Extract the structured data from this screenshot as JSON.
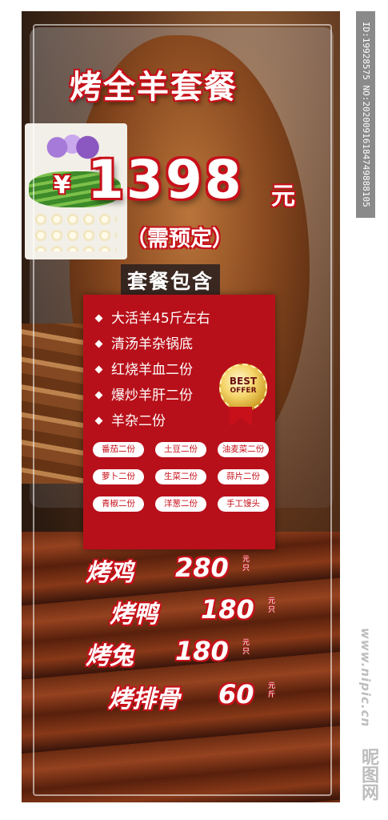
{
  "poster": {
    "title": "烤全羊套餐",
    "price": {
      "currency": "¥",
      "amount": "1398",
      "unit": "元"
    },
    "reserve_note": "（需预定）",
    "package_label": "套餐包含",
    "items": [
      "大活羊45斤左右",
      "清汤羊杂锅底",
      "红烧羊血二份",
      "爆炒羊肝二份",
      "羊杂二份"
    ],
    "tags": [
      "番茄二份",
      "土豆二份",
      "油麦菜二份",
      "萝卜二份",
      "生菜二份",
      "蒜片二份",
      "青椒二份",
      "洋葱二份",
      "手工馒头"
    ],
    "badge": {
      "line1": "BEST",
      "line2": "OFFER"
    },
    "menu": [
      {
        "name": "烤鸡",
        "price": "280",
        "unit": "元只"
      },
      {
        "name": "烤鸭",
        "price": "180",
        "unit": "元只"
      },
      {
        "name": "烤兔",
        "price": "180",
        "unit": "元只"
      },
      {
        "name": "烤排骨",
        "price": "60",
        "unit": "元斤"
      }
    ]
  },
  "watermark": {
    "id_text": "ID:19928575 NO:20200916184749888105",
    "site": "www.nipic.cn",
    "brand": "昵图网"
  },
  "colors": {
    "accent_red": "#c7101a",
    "box_red": "#b8101a",
    "text_white": "#ffffff"
  }
}
